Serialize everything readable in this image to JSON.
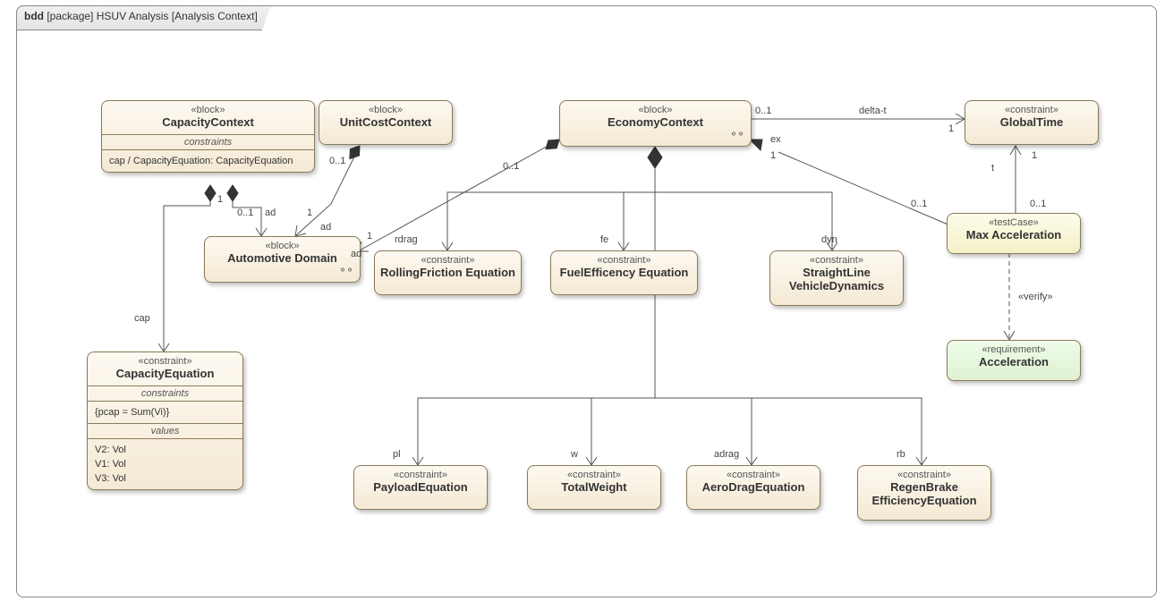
{
  "frame": {
    "kind": "bdd",
    "type_prefix": "[package]",
    "title": "HSUV Analysis",
    "suffix": "[Analysis Context]"
  },
  "nodes": {
    "capacityContext": {
      "stereo": "«block»",
      "name": "CapacityContext",
      "section1_title": "constraints",
      "section1_line": "cap / CapacityEquation: CapacityEquation"
    },
    "unitCostContext": {
      "stereo": "«block»",
      "name": "UnitCostContext"
    },
    "economyContext": {
      "stereo": "«block»",
      "name": "EconomyContext"
    },
    "globalTime": {
      "stereo": "«constraint»",
      "name": "GlobalTime"
    },
    "automotiveDomain": {
      "stereo": "«block»",
      "name": "Automotive Domain"
    },
    "rollingFriction": {
      "stereo": "«constraint»",
      "name": "RollingFriction Equation"
    },
    "fuelEfficiency": {
      "stereo": "«constraint»",
      "name": "FuelEfficency Equation"
    },
    "straightLine": {
      "stereo": "«constraint»",
      "name1": "StraightLine",
      "name2": "VehicleDynamics"
    },
    "maxAccel": {
      "stereo": "«testCase»",
      "name": "Max Acceleration"
    },
    "acceleration": {
      "stereo": "«requirement»",
      "name": "Acceleration"
    },
    "payloadEquation": {
      "stereo": "«constraint»",
      "name": "PayloadEquation"
    },
    "totalWeight": {
      "stereo": "«constraint»",
      "name": "TotalWeight"
    },
    "aeroDrag": {
      "stereo": "«constraint»",
      "name": "AeroDragEquation"
    },
    "regenBrake": {
      "stereo": "«constraint»",
      "name1": "RegenBrake",
      "name2": "EfficiencyEquation"
    },
    "capacityEquation": {
      "stereo": "«constraint»",
      "name": "CapacityEquation",
      "sec1_title": "constraints",
      "sec1_line": "{pcap = Sum(Vi)}",
      "sec2_title": "values",
      "sec2_l1": "V2: Vol",
      "sec2_l2": "V1: Vol",
      "sec2_l3": "V3: Vol"
    }
  },
  "labels": {
    "cap": "cap",
    "ad": "ad",
    "one": "1",
    "zeroToOne": "0..1",
    "rdrag": "rdrag",
    "fe": "fe",
    "dyn": "dyn",
    "pl": "pl",
    "w": "w",
    "adrag": "adrag",
    "rb": "rb",
    "delta_t": "delta-t",
    "ex": "ex",
    "t": "t",
    "verify": "«verify»"
  },
  "chart_data": {
    "type": "table",
    "description": "SysML Block Definition Diagram (bdd) for HSUV Analysis — Analysis Context package",
    "blocks": [
      {
        "name": "CapacityContext",
        "stereotype": "block",
        "compartments": {
          "constraints": [
            "cap / CapacityEquation: CapacityEquation"
          ]
        }
      },
      {
        "name": "UnitCostContext",
        "stereotype": "block"
      },
      {
        "name": "EconomyContext",
        "stereotype": "block"
      },
      {
        "name": "Automotive Domain",
        "stereotype": "block"
      },
      {
        "name": "GlobalTime",
        "stereotype": "constraint"
      },
      {
        "name": "RollingFriction Equation",
        "stereotype": "constraint"
      },
      {
        "name": "FuelEfficency Equation",
        "stereotype": "constraint"
      },
      {
        "name": "StraightLine VehicleDynamics",
        "stereotype": "constraint"
      },
      {
        "name": "PayloadEquation",
        "stereotype": "constraint"
      },
      {
        "name": "TotalWeight",
        "stereotype": "constraint"
      },
      {
        "name": "AeroDragEquation",
        "stereotype": "constraint"
      },
      {
        "name": "RegenBrake EfficiencyEquation",
        "stereotype": "constraint"
      },
      {
        "name": "CapacityEquation",
        "stereotype": "constraint",
        "compartments": {
          "constraints": [
            "{pcap = Sum(Vi)}"
          ],
          "values": [
            "V2: Vol",
            "V1: Vol",
            "V3: Vol"
          ]
        }
      },
      {
        "name": "Max Acceleration",
        "stereotype": "testCase"
      },
      {
        "name": "Acceleration",
        "stereotype": "requirement"
      }
    ],
    "relationships": [
      {
        "type": "composition",
        "whole": "CapacityContext",
        "part": "CapacityEquation",
        "role": "cap"
      },
      {
        "type": "composition",
        "whole": "CapacityContext",
        "part": "Automotive Domain",
        "role": "ad",
        "whole_mult": "1",
        "part_mult": "0..1"
      },
      {
        "type": "composition",
        "whole": "UnitCostContext",
        "part": "Automotive Domain",
        "role": "ad",
        "whole_mult": "1",
        "part_mult": "0..1"
      },
      {
        "type": "composition",
        "whole": "EconomyContext",
        "part": "Automotive Domain",
        "role": "ad",
        "whole_mult": "1",
        "part_mult": "0..1"
      },
      {
        "type": "composition",
        "whole": "EconomyContext",
        "part": "RollingFriction Equation",
        "role": "rdrag"
      },
      {
        "type": "composition",
        "whole": "EconomyContext",
        "part": "FuelEfficency Equation",
        "role": "fe"
      },
      {
        "type": "composition",
        "whole": "EconomyContext",
        "part": "StraightLine VehicleDynamics",
        "role": "dyn"
      },
      {
        "type": "composition",
        "whole": "EconomyContext",
        "part": "PayloadEquation",
        "role": "pl"
      },
      {
        "type": "composition",
        "whole": "EconomyContext",
        "part": "TotalWeight",
        "role": "w"
      },
      {
        "type": "composition",
        "whole": "EconomyContext",
        "part": "AeroDragEquation",
        "role": "adrag"
      },
      {
        "type": "composition",
        "whole": "EconomyContext",
        "part": "RegenBrake EfficiencyEquation",
        "role": "rb"
      },
      {
        "type": "association",
        "from": "EconomyContext",
        "to": "GlobalTime",
        "role": "delta-t",
        "from_mult": "0..1",
        "to_mult": "1"
      },
      {
        "type": "association",
        "from": "Max Acceleration",
        "to": "EconomyContext",
        "role": "ex",
        "from_mult": "0..1",
        "to_mult": "1"
      },
      {
        "type": "association",
        "from": "Max Acceleration",
        "to": "GlobalTime",
        "role": "t",
        "from_mult": "0..1",
        "to_mult": "1"
      },
      {
        "type": "dependency",
        "from": "Max Acceleration",
        "to": "Acceleration",
        "stereotype": "verify"
      }
    ]
  }
}
